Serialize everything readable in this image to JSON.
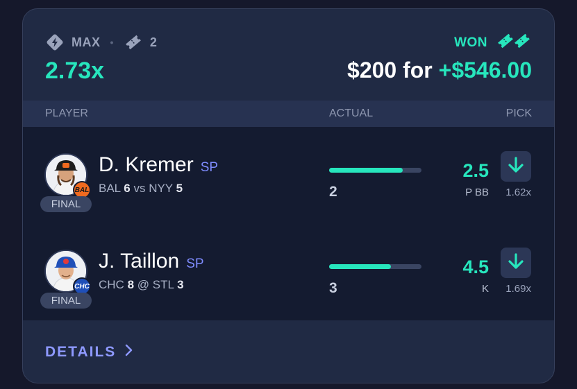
{
  "header": {
    "mode_label": "MAX",
    "mode_icon": "lightning-diamond-icon",
    "ticket_count": "2",
    "ticket_icon": "ticket-icon",
    "multiplier": "2.73x",
    "result_label": "WON",
    "result_icon": "tickets-icon",
    "stake": "$200 for ",
    "winnings": "+$546.00"
  },
  "table": {
    "col_player": "PLAYER",
    "col_actual": "ACTUAL",
    "col_pick": "PICK"
  },
  "rows": [
    {
      "name": "D. Kremer",
      "position": "SP",
      "team_badge": "BAL",
      "status": "FINAL",
      "team": "BAL",
      "team_score": "6",
      "sep": "vs",
      "opp": "NYY",
      "opp_score": "5",
      "actual": "2",
      "progress": 0.8,
      "line": "2.5",
      "stat": "P BB",
      "pick_direction": "under",
      "pick_icon": "arrow-down-icon",
      "pick_multiplier": "1.62x"
    },
    {
      "name": "J. Taillon",
      "position": "SP",
      "team_badge": "CHC",
      "status": "FINAL",
      "team": "CHC",
      "team_score": "8",
      "sep": "@",
      "opp": "STL",
      "opp_score": "3",
      "actual": "3",
      "progress": 0.67,
      "line": "4.5",
      "stat": "K",
      "pick_direction": "under",
      "pick_icon": "arrow-down-icon",
      "pick_multiplier": "1.69x"
    }
  ],
  "footer": {
    "details_label": "DETAILS",
    "details_icon": "chevron-right-icon"
  },
  "colors": {
    "accent": "#27e6bd",
    "link": "#8e99ff",
    "card": "#202a44",
    "background": "#15182b"
  }
}
